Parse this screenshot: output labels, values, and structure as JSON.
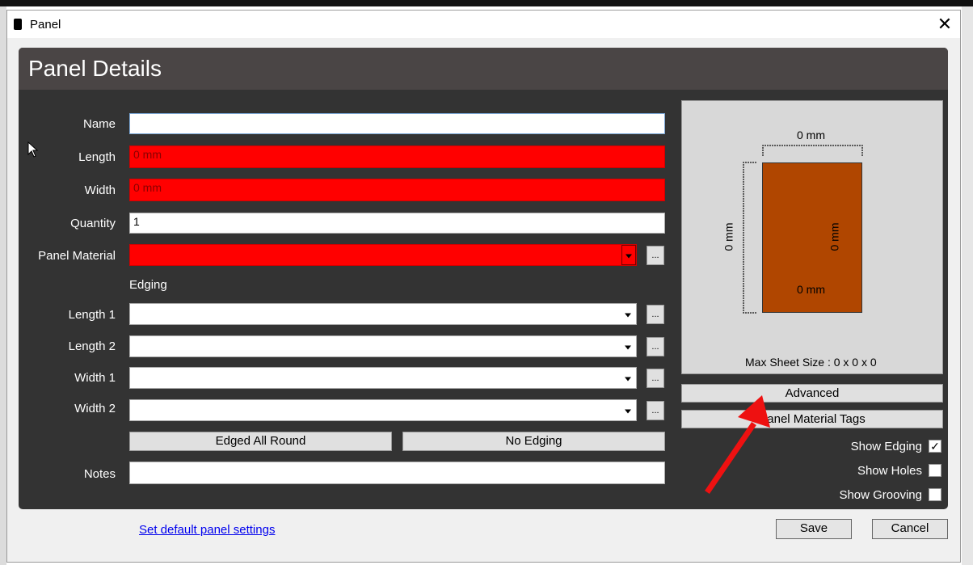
{
  "window": {
    "title": "Panel"
  },
  "header": {
    "title": "Panel Details"
  },
  "form": {
    "name_label": "Name",
    "name_value": "",
    "length_label": "Length",
    "length_value": "0 mm",
    "width_label": "Width",
    "width_value": "0 mm",
    "quantity_label": "Quantity",
    "quantity_value": "1",
    "material_label": "Panel Material",
    "material_value": "",
    "edging_heading": "Edging",
    "edging": [
      {
        "label": "Length 1",
        "value": ""
      },
      {
        "label": "Length 2",
        "value": ""
      },
      {
        "label": "Width 1",
        "value": ""
      },
      {
        "label": "Width 2",
        "value": ""
      }
    ],
    "ellipsis": "...",
    "edged_all_round": "Edged All Round",
    "no_edging": "No Edging",
    "notes_label": "Notes",
    "notes_value": ""
  },
  "preview": {
    "top_dim": "0 mm",
    "left_dim": "0 mm",
    "right_dim": "0 mm",
    "bottom_dim": "0 mm",
    "max_sheet": "Max Sheet Size : 0 x 0 x 0",
    "panel_color": "#b04600"
  },
  "side": {
    "advanced": "Advanced",
    "material_tags": "Panel Material Tags",
    "show_edging": "Show Edging",
    "show_edging_checked": true,
    "show_holes": "Show Holes",
    "show_holes_checked": false,
    "show_grooving": "Show Grooving",
    "show_grooving_checked": false
  },
  "footer": {
    "default_link": "Set default panel settings",
    "save": "Save",
    "cancel": "Cancel"
  },
  "colors": {
    "error": "#ff0000",
    "dark_bg": "#333333",
    "annotation_arrow": "#ee1111"
  }
}
